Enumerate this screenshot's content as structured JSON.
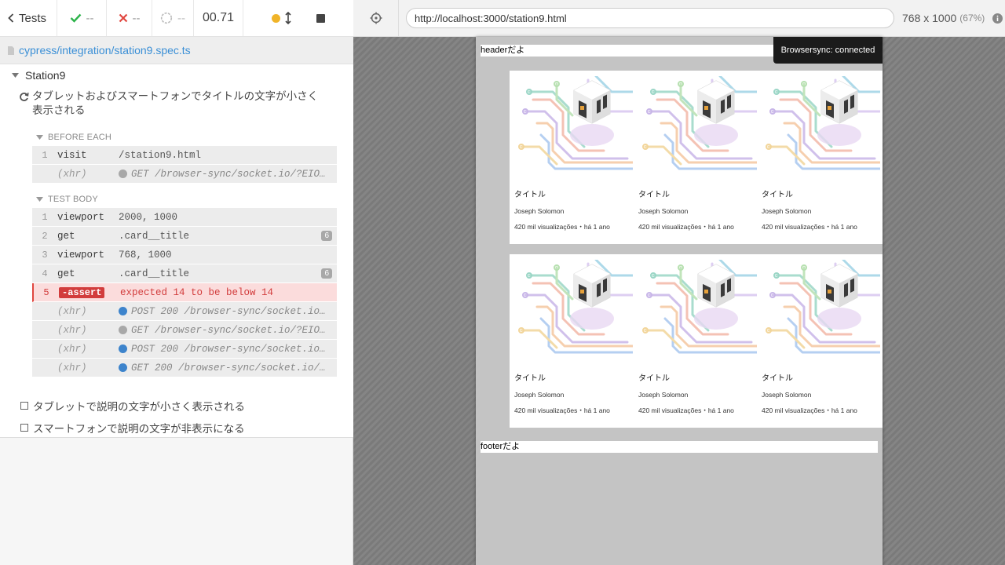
{
  "reporter": {
    "tests_label": "Tests",
    "passed": "--",
    "failed": "--",
    "pending": "--",
    "duration": "00.71",
    "spec_path": "cypress/integration/station9.spec.ts",
    "suite_title": "Station9",
    "test_title": "タブレットおよびスマートフォンでタイトルの文字が小さく表示される",
    "before_each_label": "BEFORE EACH",
    "test_body_label": "TEST BODY",
    "before_each_commands": [
      {
        "num": "1",
        "name": "visit",
        "message": "/station9.html"
      },
      {
        "num": "",
        "name": "(xhr)",
        "message": "GET /browser-sync/socket.io/?EIO=..."
      }
    ],
    "body_commands": [
      {
        "num": "1",
        "name": "viewport",
        "message": "2000, 1000"
      },
      {
        "num": "2",
        "name": "get",
        "message": ".card__title",
        "badge": "6"
      },
      {
        "num": "3",
        "name": "viewport",
        "message": "768, 1000"
      },
      {
        "num": "4",
        "name": "get",
        "message": ".card__title",
        "badge": "6"
      },
      {
        "num": "5",
        "name": "-assert",
        "message": "expected 14 to be below 14"
      },
      {
        "num": "",
        "name": "(xhr)",
        "message": "POST 200 /browser-sync/socket.io/..."
      },
      {
        "num": "",
        "name": "(xhr)",
        "message": "GET /browser-sync/socket.io/?EIO=..."
      },
      {
        "num": "",
        "name": "(xhr)",
        "message": "POST 200 /browser-sync/socket.io/..."
      },
      {
        "num": "",
        "name": "(xhr)",
        "message": "GET 200 /browser-sync/socket.io/?..."
      }
    ],
    "pending_tests": [
      "タブレットで説明の文字が小さく表示される",
      "スマートフォンで説明の文字が非表示になる"
    ]
  },
  "aut": {
    "url": "http://localhost:3000/station9.html",
    "viewport_size": "768 x 1000",
    "scale": "(67%)",
    "toast": "Browsersync: connected",
    "header_text": "headerだよ",
    "footer_text": "footerだよ",
    "card_title": "タイトル",
    "card_author": "Joseph Solomon",
    "card_meta": "420 mil visualizações・há 1 ano"
  },
  "colors": {
    "passed": "#2cb34a",
    "failed": "#e0463f",
    "link": "#3a8fd6",
    "xhr_blue": "#3d84cc",
    "running_dot": "#f0b429"
  }
}
